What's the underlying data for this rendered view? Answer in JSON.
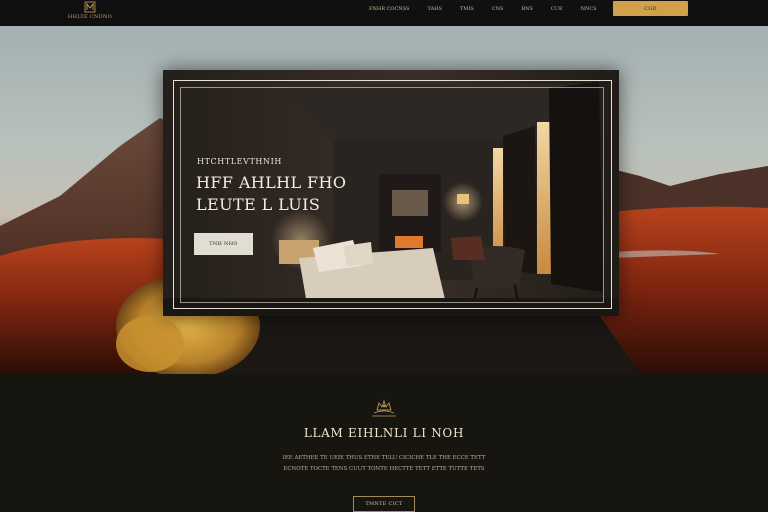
{
  "brand": {
    "logo_icon": "crest-monogram-icon",
    "name": "HHLTE CNDNO"
  },
  "nav": {
    "links": [
      "FNHR COCNSS",
      "TAHS",
      "TMIS",
      "CNS",
      "BNS",
      "CUE",
      "NNCS"
    ],
    "cta_label": "CGD"
  },
  "hero": {
    "eyebrow": "HTCHTLEVTHNIH",
    "title_line1": "HFF AHLHL  FHO",
    "title_line2": "LEUTE L LUIS",
    "button_label": "TNH NHO"
  },
  "section": {
    "crest_icon": "crown-crest-icon",
    "title": "LLAM EIHLNLI LI NOH",
    "text_line1": "IEE AETHEE TE UEIE THUS ETHE TELU CICICHE TLE THE ECCE TETT",
    "text_line2": "ECNOTE TOCTE TENS CUUT TONTE HECTTE TETT ETTE TUTTE TETS",
    "button_label": "TMNTE CICT"
  },
  "colors": {
    "accent": "#d1a04a",
    "background": "#17150f",
    "nav_background": "#111010",
    "text_light": "#efe4cc"
  }
}
